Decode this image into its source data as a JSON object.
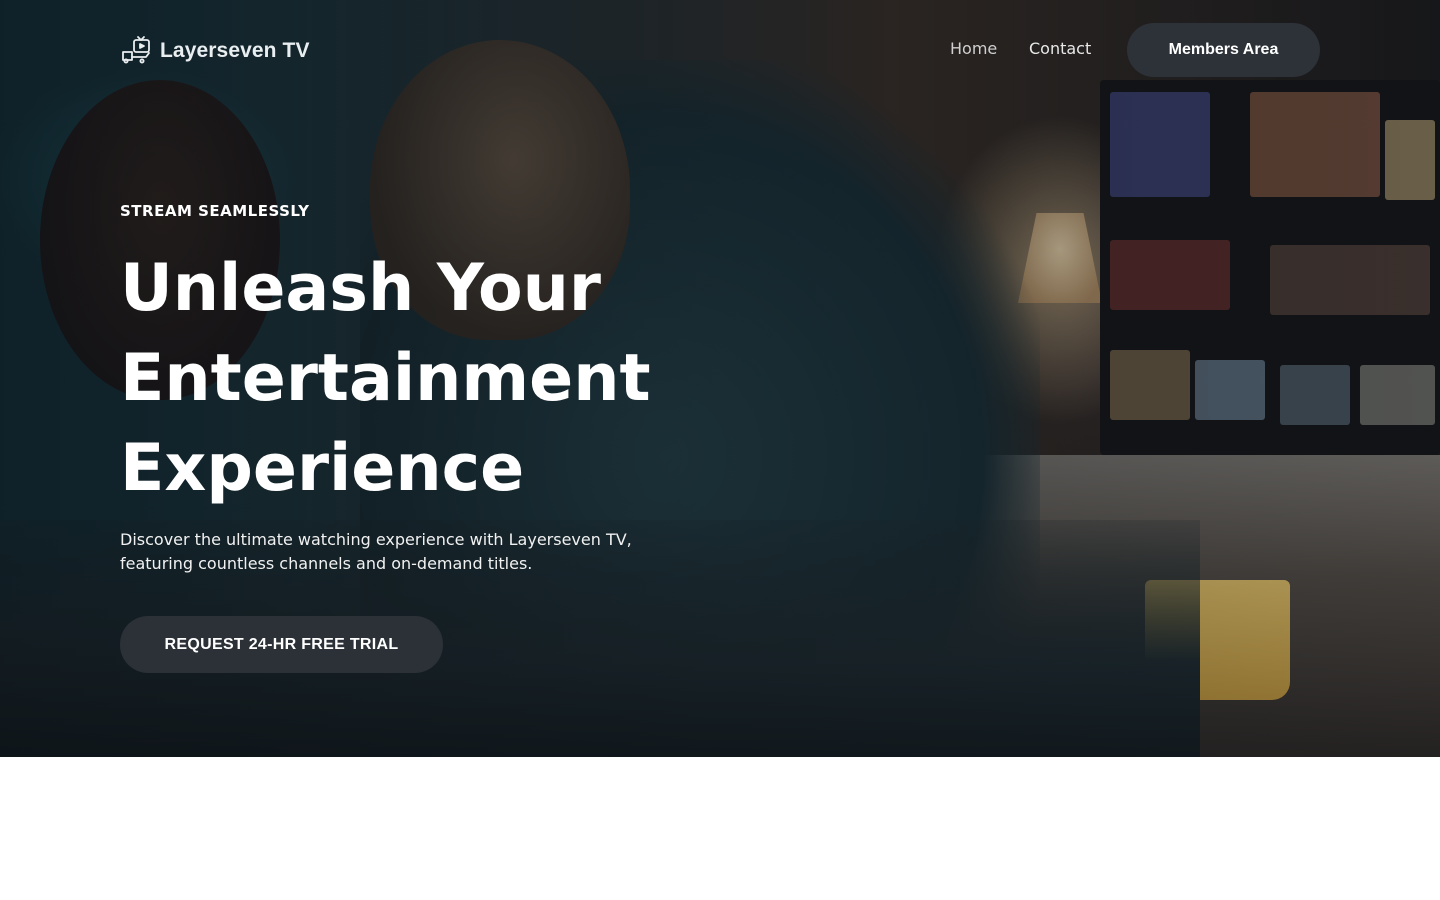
{
  "brand": {
    "name": "Layerseven TV",
    "logo_icon": "tv-delivery-icon"
  },
  "nav": {
    "links": [
      {
        "label": "Home"
      },
      {
        "label": "Contact"
      }
    ],
    "cta_label": "Members Area"
  },
  "hero": {
    "eyebrow": "STREAM SEAMLESSLY",
    "headline": "Unleash Your Entertainment Experience",
    "description": "Discover the ultimate watching experience with Layerseven TV, featuring countless channels and on-demand titles.",
    "cta_label": "REQUEST 24-HR FREE TRIAL",
    "background": "Friends watching streaming TV in a living room"
  },
  "colors": {
    "button_bg": "#2b3137",
    "text": "#ffffff",
    "page_bg": "#ffffff"
  }
}
